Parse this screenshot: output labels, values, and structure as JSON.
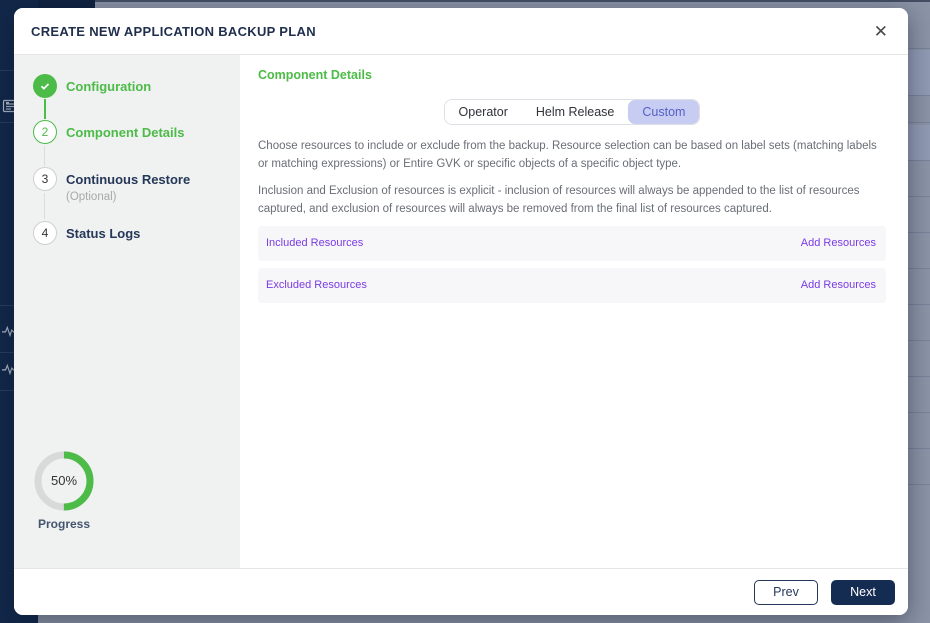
{
  "modal": {
    "title": "CREATE NEW APPLICATION BACKUP PLAN",
    "close_icon": "✕"
  },
  "wizard": {
    "steps": [
      {
        "number": "",
        "label": "Configuration",
        "state": "complete"
      },
      {
        "number": "2",
        "label": "Component Details",
        "state": "active"
      },
      {
        "number": "3",
        "label": "Continuous Restore",
        "sublabel": "(Optional)",
        "state": "pending"
      },
      {
        "number": "4",
        "label": "Status Logs",
        "state": "pending"
      }
    ],
    "progress": {
      "value": 50,
      "percent": "50%",
      "label": "Progress"
    }
  },
  "content": {
    "heading": "Component Details",
    "tabs": [
      {
        "label": "Operator",
        "active": false
      },
      {
        "label": "Helm Release",
        "active": false
      },
      {
        "label": "Custom",
        "active": true
      }
    ],
    "description_1": "Choose resources to include or exclude from the backup. Resource selection can be based on label sets (matching labels or matching expressions) or Entire GVK or specific objects of a specific object type.",
    "description_2": "Inclusion and Exclusion of resources is explicit - inclusion of resources will always be appended to the list of resources captured, and exclusion of resources will always be removed from the final list of resources captured.",
    "panels": [
      {
        "title": "Included Resources",
        "action": "Add Resources"
      },
      {
        "title": "Excluded Resources",
        "action": "Add Resources"
      }
    ]
  },
  "footer": {
    "prev_label": "Prev",
    "next_label": "Next"
  },
  "colors": {
    "green": "#4cbb47",
    "purple": "#7b3be4",
    "navy": "#152c52",
    "tab_active_bg": "#c7ccf3",
    "tab_active_text": "#5560c5",
    "scrim": "#8b93a6",
    "sidebar_navy": "#12284a"
  }
}
